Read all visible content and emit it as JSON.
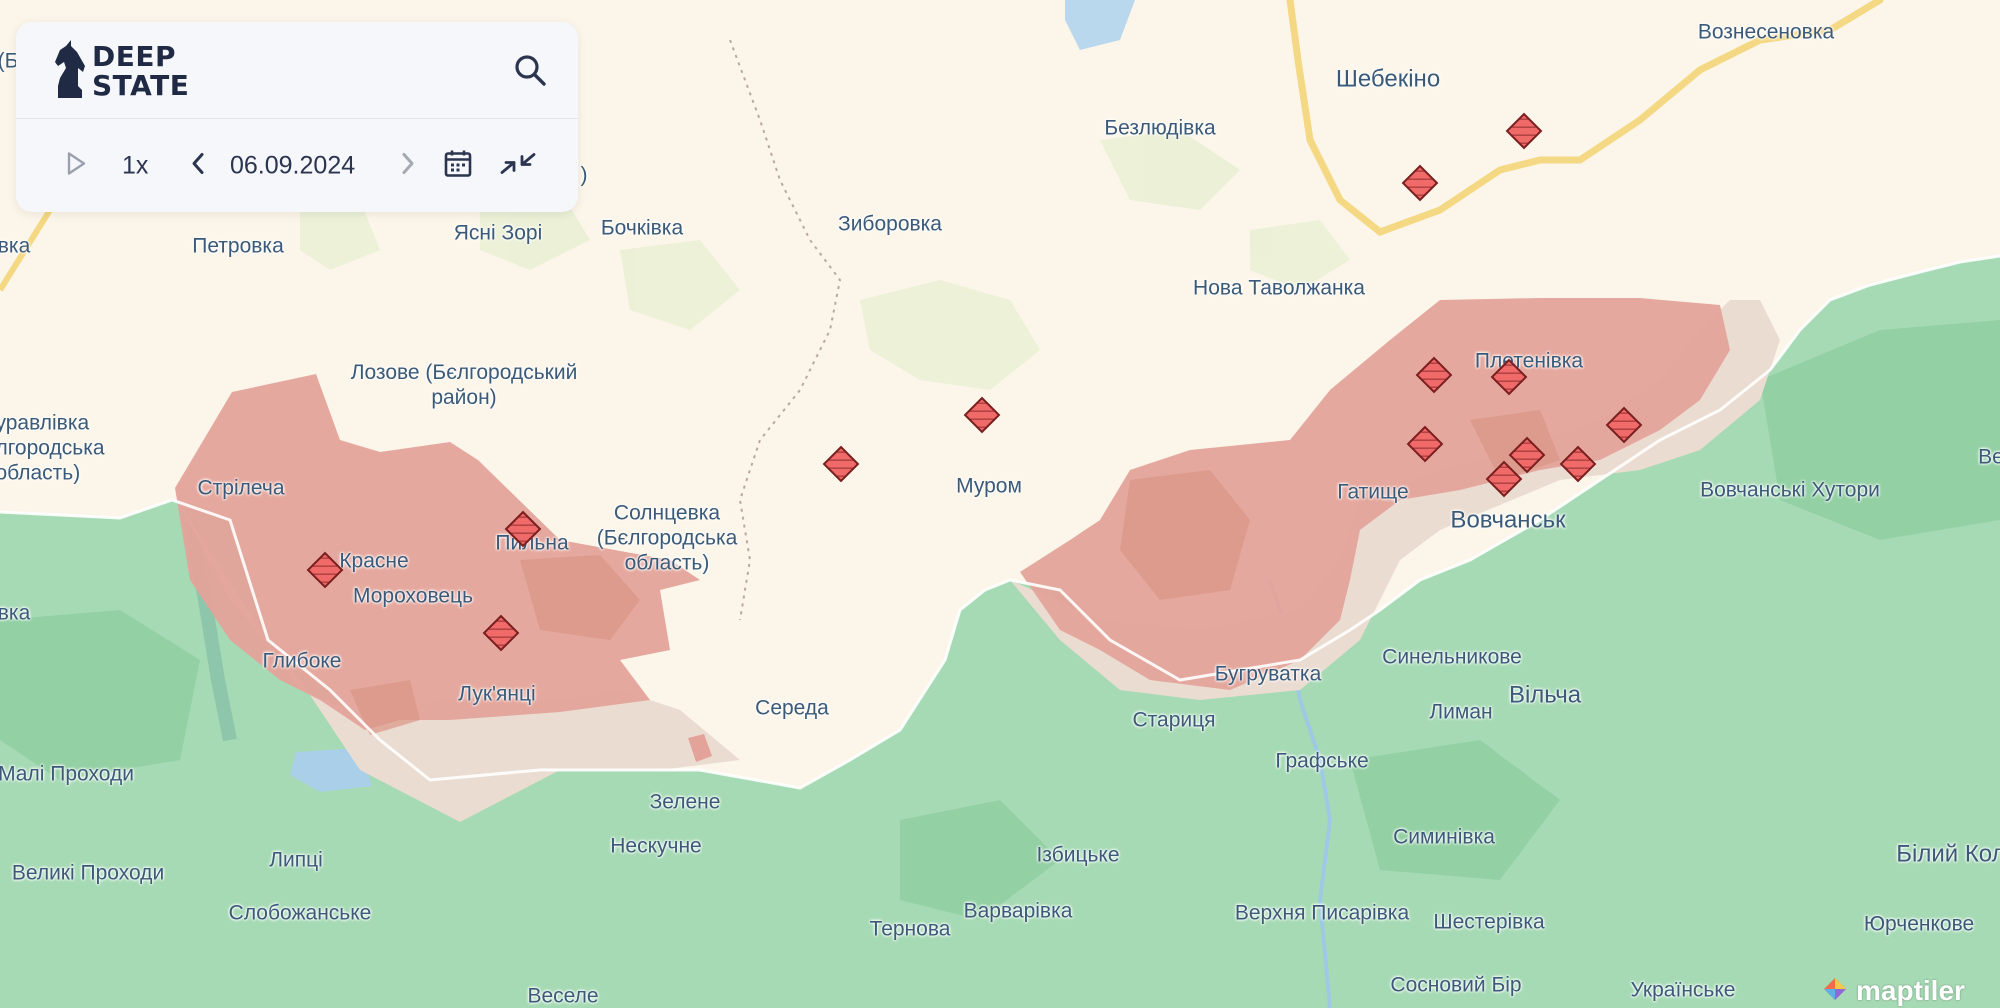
{
  "app": {
    "logo_line1": "DEEP",
    "logo_line2": "STATE",
    "attribution": "maptiler"
  },
  "controls": {
    "speed": "1x",
    "date": "06.09.2024"
  },
  "icons": {
    "search": "search-icon",
    "play": "play-icon",
    "prev": "chevron-left-icon",
    "next": "chevron-right-icon",
    "calendar": "calendar-icon",
    "collapse": "collapse-arrows-icon",
    "marker": "hatched-diamond-marker-icon"
  },
  "colors": {
    "russia_bg": "#fcf6ea",
    "ukraine_bg": "#a6dab5",
    "occupied": "#e4a39a",
    "contested": "#ebdcd2",
    "marker_fill": "#ef6a69",
    "marker_stroke": "#7a1f20",
    "label": "#3b5a78",
    "panel_bg": "#f6f7fa",
    "road": "#f4d883"
  },
  "map": {
    "labels": {
      "shebekino": "Шебекіно",
      "voznesenovka": "Вознесеновка",
      "bezliudivka": "Безлюдівка",
      "petrovka": "Петровка",
      "yasni_zori": "Ясні Зорі",
      "bochkivka": "Бочківка",
      "zyborovka": "Зиборовка",
      "nova_tavolzhanka": "Нова Таволжанка",
      "lozove": "Лозове (Бєлгородський\nрайон)",
      "zhuravlivka": "уравлівка\nлгородська\nобласть)",
      "pletenivka": "Плетенівка",
      "murom": "Муром",
      "strilecha": "Стрілеча",
      "pylna": "Пильна",
      "krasne": "Красне",
      "solntsevka": "Солнцевка\n(Бєлгородська\nобласть)",
      "gatyshche": "Гатище",
      "vovchansk": "Вовчанськ",
      "vovchanski_khutory": "Вовчанські Хутори",
      "morokhovets": "Мороховець",
      "hlyboke": "Глибоке",
      "lukiantsi": "Лук'янці",
      "bugruvatka": "Бугруватка",
      "synelnykove": "Синельникове",
      "vilcha": "Вільча",
      "lyman": "Лиман",
      "serednia": "Середа",
      "starytsia": "Стариця",
      "malі_prokhody": "Малі Проходи",
      "grafske": "Графське",
      "zelene": "Зелене",
      "neskuchne": "Нескучне",
      "symynivka": "Симинівка",
      "izbytske": "Ізбицьке",
      "bilyi_kolodiaz": "Білий Кол",
      "lyptsi": "Липці",
      "velyki_prokhody": "Великі Проходи",
      "slobozhanske": "Слобожанське",
      "varvarivka": "Варварівка",
      "verkhnia_pysarivka": "Верхня Писарівка",
      "shesterivka": "Шестерівка",
      "yurchenkove": "Юрченкове",
      "ternova": "Тернова",
      "sosnovyi_bir": "Сосновий Бір",
      "ukrainske": "Українське",
      "veselе": "Веселе",
      "edge_b": "(Б",
      "edge_paren": ")",
      "edge_vka": "вка",
      "edge_vka2": "вка",
      "edge_ve": "Ве"
    }
  }
}
